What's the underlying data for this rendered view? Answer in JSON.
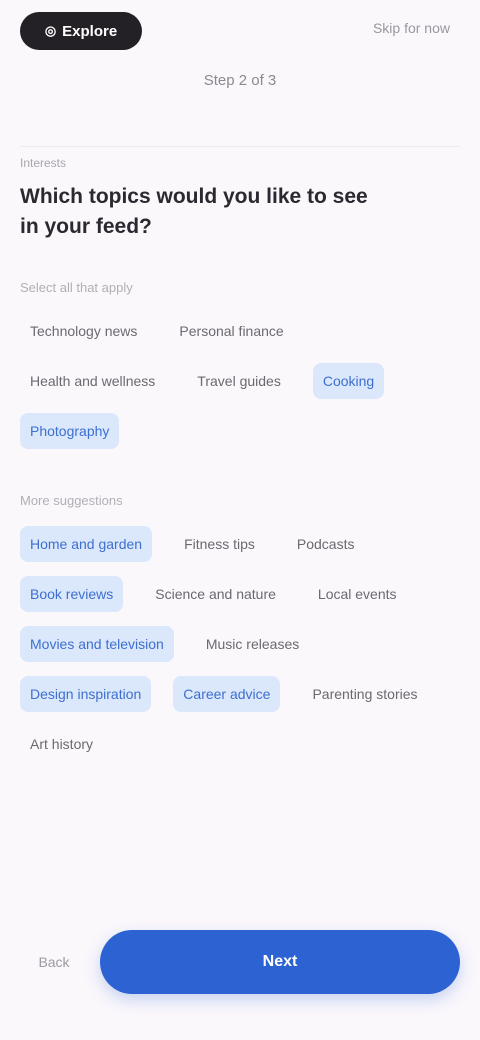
{
  "header": {
    "brand": "Explore",
    "top_right": "Skip for now",
    "step": "Step 2 of 3"
  },
  "content": {
    "kicker": "Interests",
    "question": "Which topics would you like to see in your feed?",
    "group_one": {
      "label": "Select all that apply",
      "chips": [
        {
          "label": "Technology news",
          "selected": false
        },
        {
          "label": "Personal finance",
          "selected": false
        },
        {
          "label": "Health and wellness",
          "selected": false
        },
        {
          "label": "Travel guides",
          "selected": false
        },
        {
          "label": "Cooking",
          "selected": true
        },
        {
          "label": "Photography",
          "selected": true
        }
      ]
    },
    "group_two": {
      "label": "More suggestions",
      "chips": [
        {
          "label": "Home and garden",
          "selected": true
        },
        {
          "label": "Fitness tips",
          "selected": false
        },
        {
          "label": "Podcasts",
          "selected": false
        },
        {
          "label": "Book reviews",
          "selected": true
        },
        {
          "label": "Science and nature",
          "selected": false
        },
        {
          "label": "Local events",
          "selected": false
        },
        {
          "label": "Movies and television",
          "selected": true
        },
        {
          "label": "Music releases",
          "selected": false
        },
        {
          "label": "Design inspiration",
          "selected": true
        },
        {
          "label": "Career advice",
          "selected": true
        },
        {
          "label": "Parenting stories",
          "selected": false
        },
        {
          "label": "Art history",
          "selected": false
        }
      ]
    }
  },
  "footer": {
    "back_label": "Back",
    "next_label": "Next"
  },
  "colors": {
    "background": "#fbf8fc",
    "accent": "#2c62d2",
    "chip_selected_bg": "#dbe8fb",
    "chip_selected_text": "#3d6fd1"
  },
  "icons": {
    "brand": "compass-icon"
  }
}
